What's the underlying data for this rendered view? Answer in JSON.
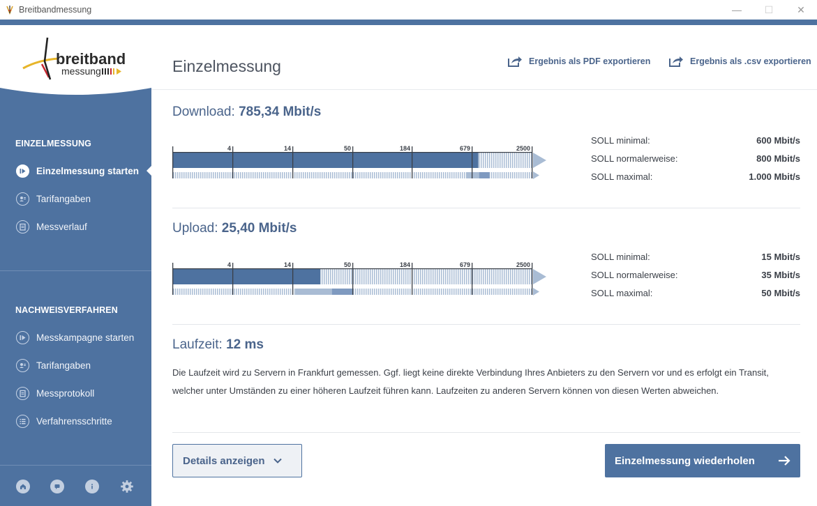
{
  "window": {
    "title": "Breitbandmessung"
  },
  "sidebar": {
    "logo": {
      "word_top": "breitband",
      "word_bottom": "messung"
    },
    "section1_heading": "EINZELMESSUNG",
    "section1_items": [
      {
        "label": "Einzelmessung starten",
        "icon": "play-icon",
        "active": true
      },
      {
        "label": "Tarifangaben",
        "icon": "user-card-icon",
        "active": false
      },
      {
        "label": "Messverlauf",
        "icon": "clipboard-icon",
        "active": false
      }
    ],
    "section2_heading": "NACHWEISVERFAHREN",
    "section2_items": [
      {
        "label": "Messkampagne starten",
        "icon": "play-icon"
      },
      {
        "label": "Tarifangaben",
        "icon": "user-card-icon"
      },
      {
        "label": "Messprotokoll",
        "icon": "clipboard-icon"
      },
      {
        "label": "Verfahrensschritte",
        "icon": "list-icon"
      }
    ],
    "footer_icons": [
      "home-icon",
      "chat-icon",
      "info-icon",
      "gear-icon"
    ]
  },
  "header": {
    "title": "Einzelmessung",
    "export_pdf": "Ergebnis als PDF exportieren",
    "export_csv": "Ergebnis als .csv exportieren"
  },
  "download": {
    "label": "Download:",
    "value": "785,34 Mbit/s",
    "measured_mbit": 785.34,
    "soll": [
      {
        "label": "SOLL minimal:",
        "value": "600 Mbit/s"
      },
      {
        "label": "SOLL normalerweise:",
        "value": "800 Mbit/s"
      },
      {
        "label": "SOLL maximal:",
        "value": "1.000 Mbit/s"
      }
    ],
    "range_min_mbit": 600,
    "range_max_mbit": 1000
  },
  "upload": {
    "label": "Upload:",
    "value": "25,40 Mbit/s",
    "measured_mbit": 25.4,
    "soll": [
      {
        "label": "SOLL minimal:",
        "value": "15 Mbit/s"
      },
      {
        "label": "SOLL normalerweise:",
        "value": "35 Mbit/s"
      },
      {
        "label": "SOLL maximal:",
        "value": "50 Mbit/s"
      }
    ],
    "range_min_mbit": 15,
    "range_max_mbit": 50
  },
  "gauge_ticks": [
    "4",
    "14",
    "50",
    "184",
    "679",
    "2500"
  ],
  "latency": {
    "label": "Laufzeit:",
    "value": "12 ms",
    "info": "Die Laufzeit wird zu Servern in Frankfurt gemessen. Ggf. liegt keine direkte Verbindung Ihres Anbieters zu den Servern vor und es erfolgt ein Transit, welcher unter Umständen zu einer höheren Laufzeit führen kann. Laufzeiten zu anderen Servern können von diesen Werten abweichen."
  },
  "buttons": {
    "details": "Details anzeigen",
    "repeat": "Einzelmessung wiederholen"
  },
  "colors": {
    "primary": "#4e72a0",
    "bar_light": "#a9bcd4",
    "bar_mid": "#7f9ac0"
  }
}
